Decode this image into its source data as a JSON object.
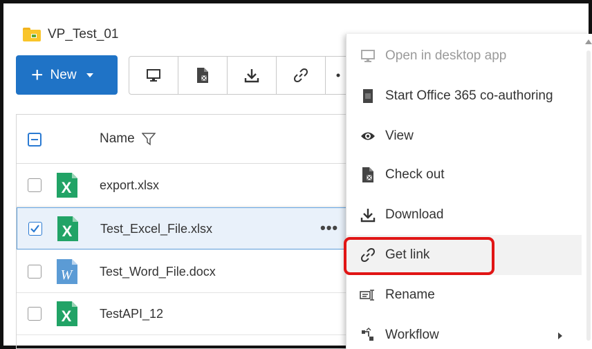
{
  "breadcrumb": {
    "folder": "VP_Test_01"
  },
  "toolbar": {
    "new_label": "New"
  },
  "grid": {
    "header": {
      "name": "Name"
    },
    "rows": [
      {
        "name": "export.xlsx",
        "type": "excel",
        "checked": false
      },
      {
        "name": "Test_Excel_File.xlsx",
        "type": "excel",
        "checked": true,
        "more": "•••"
      },
      {
        "name": "Test_Word_File.docx",
        "type": "word",
        "checked": false
      },
      {
        "name": "TestAPI_12",
        "type": "excel",
        "checked": false
      }
    ]
  },
  "menu": {
    "items": [
      {
        "label": "Open in desktop app",
        "icon": "monitor-icon",
        "disabled": true
      },
      {
        "label": "Start Office 365 co-authoring",
        "icon": "office-icon"
      },
      {
        "label": "View",
        "icon": "eye-icon"
      },
      {
        "label": "Check out",
        "icon": "checkout-icon"
      },
      {
        "label": "Download",
        "icon": "download-icon"
      },
      {
        "label": "Get link",
        "icon": "link-icon",
        "highlighted": true
      },
      {
        "label": "Rename",
        "icon": "rename-icon"
      },
      {
        "label": "Workflow",
        "icon": "workflow-icon",
        "submenu": true
      }
    ]
  },
  "colors": {
    "accent": "#1f73c6",
    "highlight": "#e11515",
    "excel": "#21a366",
    "word": "#5b9bd5"
  }
}
